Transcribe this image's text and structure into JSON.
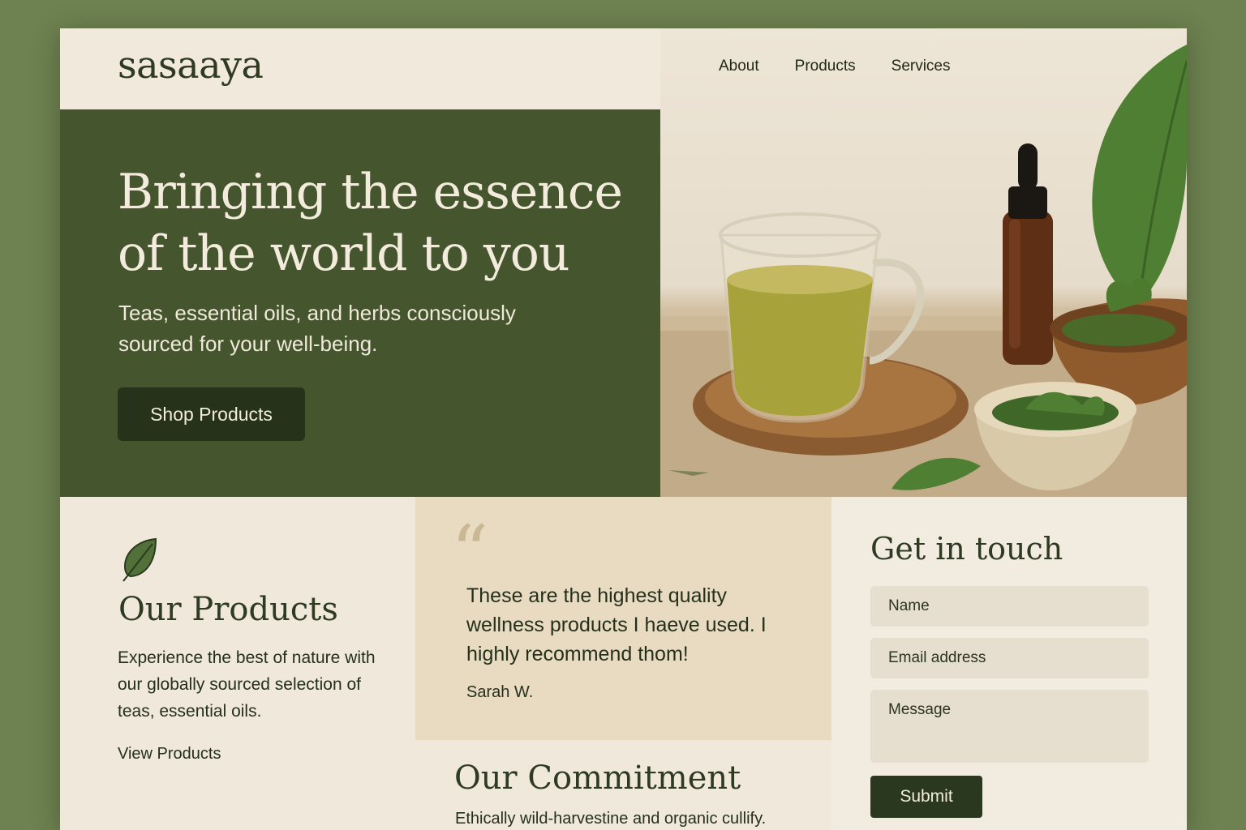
{
  "brand": {
    "logo": "sasaaya"
  },
  "nav": {
    "items": [
      "About",
      "Products",
      "Services"
    ]
  },
  "hero": {
    "title": "Bringing the essence of the world to you",
    "subtitle": "Teas, essential oils, and herbs consciously sourced for your well-being.",
    "cta_label": "Shop Products"
  },
  "products": {
    "icon": "leaf-icon",
    "heading": "Our Products",
    "body": "Experience the best of nature with our globally sourced selection of teas, essential oils.",
    "link_label": "View Products"
  },
  "testimonial": {
    "quote_mark": "“",
    "text": "These are the highest quality wellness products I haeve used. I highly recommend thom!",
    "author": "Sarah W."
  },
  "commitment": {
    "heading": "Our Commitment",
    "body": "Ethically wild-harvestine and organic cullify."
  },
  "contact": {
    "heading": "Get in touch",
    "name_placeholder": "Name",
    "email_placeholder": "Email address",
    "message_placeholder": "Message",
    "submit_label": "Submit"
  },
  "colors": {
    "background": "#6e8150",
    "hero_green": "#45552e",
    "dark_green": "#26331a",
    "cream": "#f0e9dc",
    "quote_bg": "#e8dbc1"
  }
}
